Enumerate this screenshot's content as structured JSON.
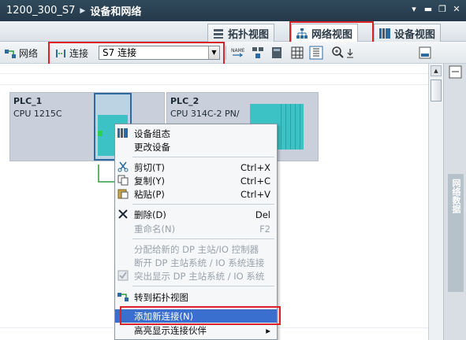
{
  "title": {
    "project": "1200_300_S7",
    "page": "设备和网络"
  },
  "window_buttons": [
    "▾",
    "▬",
    "❐",
    "✕"
  ],
  "view_tabs": {
    "topology": "拓扑视图",
    "network": "网络视图",
    "device": "设备视图"
  },
  "toolbar": {
    "network_label": "网络",
    "connection_label": "连接",
    "connection_type": "S7 连接"
  },
  "devices": [
    {
      "name": "PLC_1",
      "type": "CPU 1215C"
    },
    {
      "name": "PLC_2",
      "type": "CPU 314C-2 PN/"
    }
  ],
  "context_menu": {
    "items": [
      {
        "label": "设备组态",
        "shortcut": ""
      },
      {
        "label": "更改设备",
        "shortcut": ""
      },
      {
        "label": "剪切(T)",
        "shortcut": "Ctrl+X"
      },
      {
        "label": "复制(Y)",
        "shortcut": "Ctrl+C"
      },
      {
        "label": "粘贴(P)",
        "shortcut": "Ctrl+V"
      },
      {
        "label": "删除(D)",
        "shortcut": "Del"
      },
      {
        "label": "重命名(N)",
        "shortcut": "F2"
      },
      {
        "label": "分配给新的 DP 主站/IO 控制器",
        "shortcut": ""
      },
      {
        "label": "断开 DP 主站系统 / IO 系统连接",
        "shortcut": ""
      },
      {
        "label": "突出显示 DP 主站系统 / IO 系统",
        "shortcut": ""
      },
      {
        "label": "转到拓扑视图",
        "shortcut": ""
      },
      {
        "label": "添加新连接(N)",
        "shortcut": ""
      },
      {
        "label": "高亮显示连接伙伴",
        "shortcut": "▸"
      }
    ]
  },
  "side_panel": {
    "label": "网络数据"
  },
  "colors": {
    "titlebar": "#2f4a5c",
    "highlight": "#3a6fd0",
    "annotation_red": "#d8232a",
    "module_teal": "#3cc2c4"
  }
}
